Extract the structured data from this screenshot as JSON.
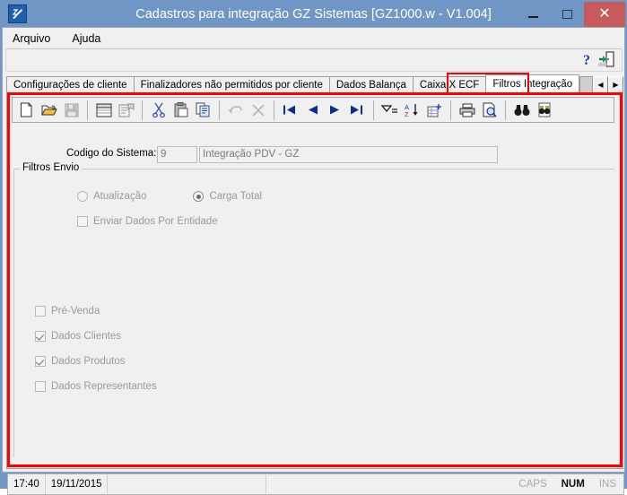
{
  "window": {
    "title": "Cadastros para integração GZ Sistemas [GZ1000.w - V1.004]",
    "app_icon": "gz-app-icon",
    "minimize_label": "",
    "maximize_label": "",
    "close_label": "✕",
    "titlebar_color": "#6f96c5",
    "close_button_color": "#c75b5b",
    "highlight_color": "#ff0000"
  },
  "menu": {
    "items": [
      {
        "label": "Arquivo"
      },
      {
        "label": "Ajuda"
      }
    ]
  },
  "help_strip": {
    "help_label": "?",
    "exit_label": ""
  },
  "tabs": {
    "items": [
      {
        "label": "Configurações de cliente",
        "active": false
      },
      {
        "label": "Finalizadores não permitidos por cliente",
        "active": false
      },
      {
        "label": "Dados Balança",
        "active": false
      },
      {
        "label": "Caixa X ECF",
        "active": false
      },
      {
        "label": "Filtros Integração",
        "active": true
      }
    ],
    "nav_prev": "◀",
    "nav_next": "▶"
  },
  "toolbar": {
    "buttons": [
      {
        "name": "new-icon",
        "title": "Novo"
      },
      {
        "name": "open-folder-icon",
        "title": "Abrir"
      },
      {
        "name": "save-disk-icon",
        "title": "Salvar"
      },
      {
        "name": "window-icon",
        "title": "Janela"
      },
      {
        "name": "properties-icon",
        "title": "Propriedades"
      },
      {
        "name": "cut-scissors-icon",
        "title": "Recortar"
      },
      {
        "name": "paste-clipboard-icon",
        "title": "Colar"
      },
      {
        "name": "copy-pages-icon",
        "title": "Copiar"
      },
      {
        "name": "undo-arrow-icon",
        "title": "Desfazer"
      },
      {
        "name": "cancel-x-icon",
        "title": "Cancelar"
      },
      {
        "name": "first-record-icon",
        "title": "Primeiro"
      },
      {
        "name": "previous-record-icon",
        "title": "Anterior"
      },
      {
        "name": "next-record-icon",
        "title": "Próximo"
      },
      {
        "name": "last-record-icon",
        "title": "Último"
      },
      {
        "name": "filter-icon",
        "title": "Filtrar"
      },
      {
        "name": "sort-az-icon",
        "title": "Ordenar"
      },
      {
        "name": "new-grid-icon",
        "title": "Grade"
      },
      {
        "name": "print-icon",
        "title": "Imprimir"
      },
      {
        "name": "print-preview-icon",
        "title": "Visualizar impressão"
      },
      {
        "name": "find-binoculars-icon",
        "title": "Localizar"
      },
      {
        "name": "find-next-icon",
        "title": "Localizar próximo"
      }
    ]
  },
  "form": {
    "codigo_label": "Codigo do Sistema:",
    "codigo_value": "9",
    "descricao_value": "Integração PDV - GZ"
  },
  "filtros_envio": {
    "group_title": "Filtros Envio",
    "radios": [
      {
        "label": "Atualização",
        "checked": false
      },
      {
        "label": "Carga Total",
        "checked": true
      }
    ],
    "entidade_checkbox": {
      "label": "Enviar Dados Por Entidade",
      "checked": false
    },
    "checkboxes": [
      {
        "label": "Pré-Venda",
        "checked": false
      },
      {
        "label": "Dados Clientes",
        "checked": true
      },
      {
        "label": "Dados Produtos",
        "checked": true
      },
      {
        "label": "Dados Representantes",
        "checked": false
      }
    ]
  },
  "statusbar": {
    "time": "17:40",
    "date": "19/11/2015",
    "middle_left": "",
    "middle_right": "",
    "caps": "CAPS",
    "num": "NUM",
    "ins": "INS"
  }
}
